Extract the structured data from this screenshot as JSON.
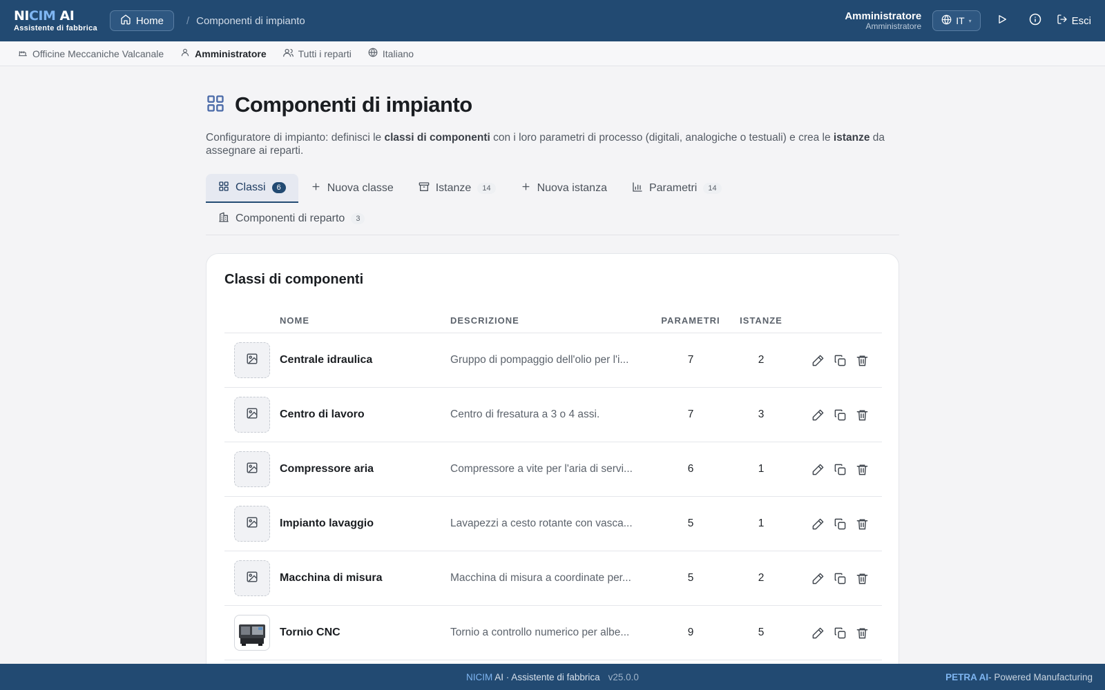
{
  "brand": {
    "title_a": "NI",
    "title_b": "CIM",
    "title_c": " AI",
    "subtitle": "Assistente di fabbrica"
  },
  "header": {
    "home_label": "Home",
    "breadcrumb_sep": "/",
    "breadcrumb": "Componenti di impianto",
    "user_name": "Amministratore",
    "user_role": "Amministratore",
    "lang_label": "IT",
    "logout_label": "Esci"
  },
  "subbar": {
    "company": "Officine Meccaniche Valcanale",
    "user": "Amministratore",
    "departments": "Tutti i reparti",
    "language": "Italiano"
  },
  "page": {
    "title": "Componenti di impianto",
    "desc_1": "Configuratore di impianto: definisci le ",
    "desc_b1": "classi di componenti",
    "desc_2": " con i loro parametri di processo (digitali, analogiche o testuali) e crea le ",
    "desc_b2": "istanze",
    "desc_3": " da assegnare ai reparti."
  },
  "tabs": [
    {
      "label": "Classi",
      "count": "6"
    },
    {
      "label": "Nuova classe"
    },
    {
      "label": "Istanze",
      "count": "14"
    },
    {
      "label": "Nuova istanza"
    },
    {
      "label": "Parametri",
      "count": "14"
    },
    {
      "label": "Componenti di reparto",
      "count": "3"
    }
  ],
  "card": {
    "title": "Classi di componenti",
    "headers": {
      "name": "NOME",
      "desc": "DESCRIZIONE",
      "params": "PARAMETRI",
      "instances": "ISTANZE"
    },
    "rows": [
      {
        "name": "Centrale idraulica",
        "desc": "Gruppo di pompaggio dell'olio per l'i...",
        "params": "7",
        "instances": "2"
      },
      {
        "name": "Centro di lavoro",
        "desc": "Centro di fresatura a 3 o 4 assi.",
        "params": "7",
        "instances": "3"
      },
      {
        "name": "Compressore aria",
        "desc": "Compressore a vite per l'aria di servi...",
        "params": "6",
        "instances": "1"
      },
      {
        "name": "Impianto lavaggio",
        "desc": "Lavapezzi a cesto rotante con vasca...",
        "params": "5",
        "instances": "1"
      },
      {
        "name": "Macchina di misura",
        "desc": "Macchina di misura a coordinate per...",
        "params": "5",
        "instances": "2"
      },
      {
        "name": "Tornio CNC",
        "desc": "Tornio a controllo numerico per albe...",
        "params": "9",
        "instances": "5"
      }
    ]
  },
  "footer": {
    "brand_hl": "NICIM",
    "brand_rest": " AI · Assistente di fabbrica",
    "version": "v25.0.0",
    "right_hl": "PETRA AI",
    "right_rest": " - Powered Manufacturing"
  },
  "colors": {
    "navy": "#224a72",
    "accent": "#7fb6f2",
    "background": "#f4f4f6"
  },
  "icons": [
    "home-icon",
    "globe-icon",
    "play-icon",
    "info-icon",
    "logout-icon",
    "factory-icon",
    "user-icon",
    "users-icon",
    "grid-icon",
    "plus-icon",
    "archive-icon",
    "bar-chart-icon",
    "building-icon",
    "image-icon",
    "edit-icon",
    "copy-icon",
    "trash-icon"
  ]
}
